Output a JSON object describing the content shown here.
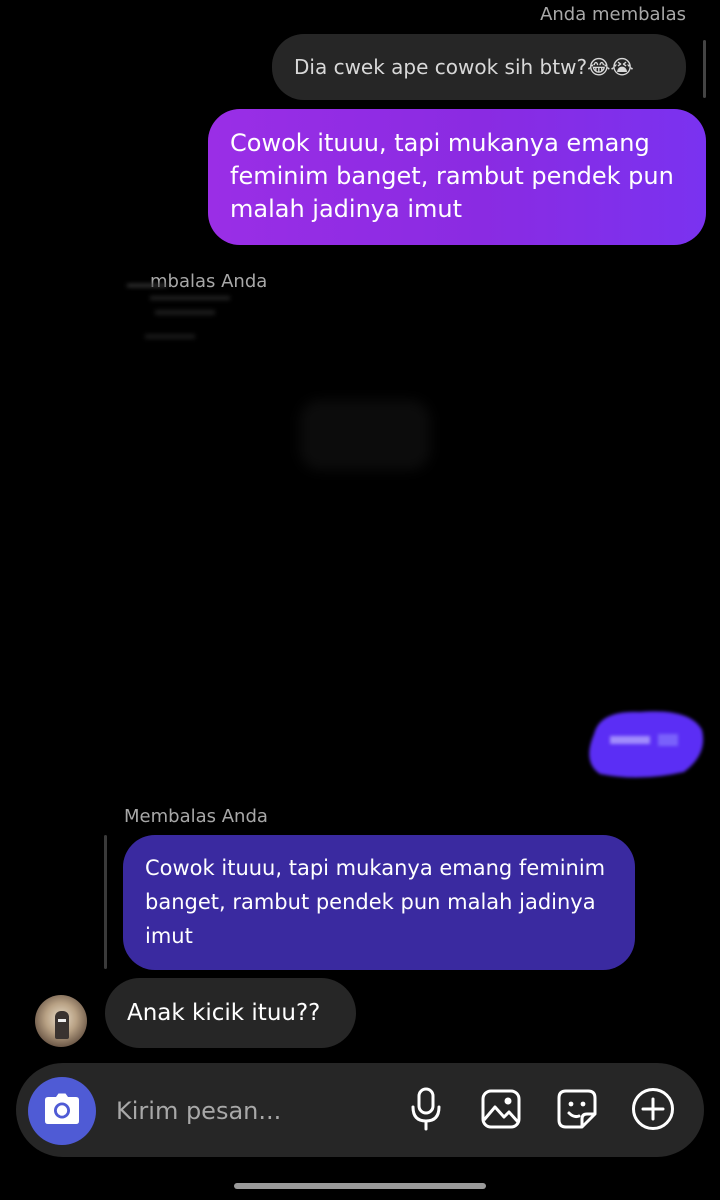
{
  "thread": {
    "reply_label_you": "Anda membalas",
    "quoted_message_1": "Dia cwek ape cowok sih btw?😂😭",
    "sent_message_1": "Cowok ituuu, tapi mukanya emang feminim banget, rambut pendek pun malah jadinya imut",
    "reply_label_them_partial": "mbalas Anda",
    "reply_label_them": "Membalas Anda",
    "quoted_message_2": "Cowok ituuu, tapi mukanya emang feminim banget, rambut pendek pun malah jadinya imut",
    "received_message": "Anak kicik ituu??"
  },
  "composer": {
    "placeholder": "Kirim pesan..."
  },
  "icons": {
    "camera": "camera-icon",
    "microphone": "microphone-icon",
    "gallery": "gallery-icon",
    "sticker": "sticker-icon",
    "plus": "plus-circle-icon"
  },
  "colors": {
    "background": "#000000",
    "sent_bubble": "#8a2be2",
    "quoted_purple": "#3a2aa0",
    "received_bubble": "#262626",
    "camera_button": "#4f5bd5"
  }
}
